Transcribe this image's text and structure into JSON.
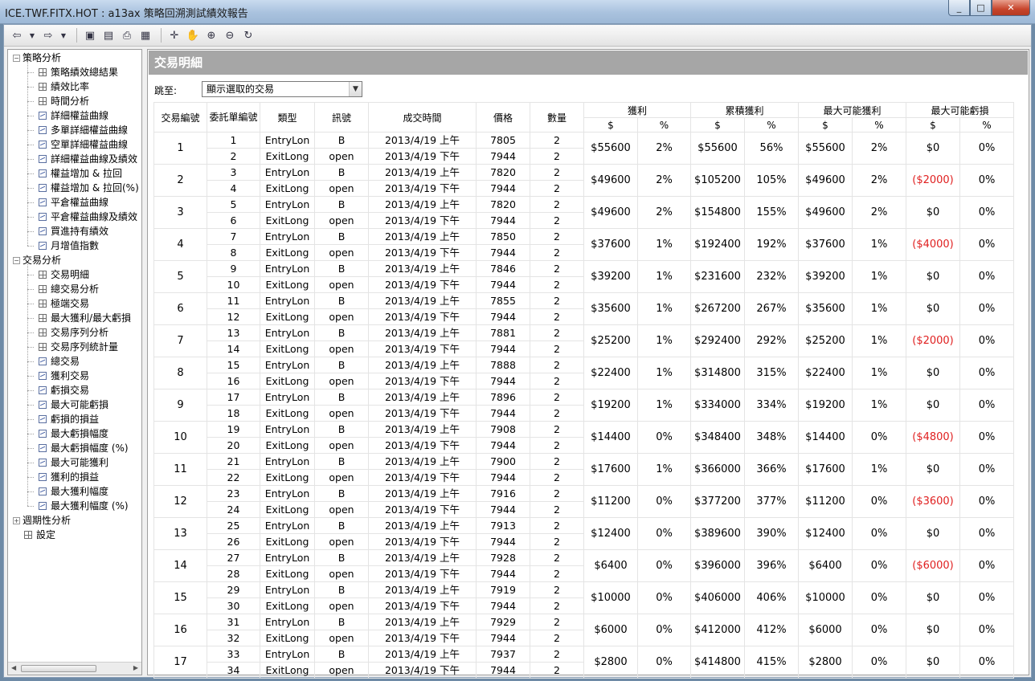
{
  "window": {
    "title": "ICE.TWF.FITX.HOT : a13ax 策略回溯測試績效報告",
    "min": "_",
    "max": "□",
    "close": "✕"
  },
  "tree": [
    {
      "label": "策略分析",
      "level": 0,
      "exp": "⊟"
    },
    {
      "label": "策略績效總結果",
      "level": 1,
      "icon": "grid"
    },
    {
      "label": "績效比率",
      "level": 1,
      "icon": "grid"
    },
    {
      "label": "時間分析",
      "level": 1,
      "icon": "grid"
    },
    {
      "label": "詳細權益曲線",
      "level": 1,
      "icon": "chart"
    },
    {
      "label": "多單詳細權益曲線",
      "level": 1,
      "icon": "chart"
    },
    {
      "label": "空單詳細權益曲線",
      "level": 1,
      "icon": "chart"
    },
    {
      "label": "詳細權益曲線及績效",
      "level": 1,
      "icon": "chart"
    },
    {
      "label": "權益增加 & 拉回",
      "level": 1,
      "icon": "chart"
    },
    {
      "label": "權益增加 & 拉回(%)",
      "level": 1,
      "icon": "chart"
    },
    {
      "label": "平倉權益曲線",
      "level": 1,
      "icon": "chart"
    },
    {
      "label": "平倉權益曲線及績效",
      "level": 1,
      "icon": "chart"
    },
    {
      "label": "買進持有績效",
      "level": 1,
      "icon": "chart"
    },
    {
      "label": "月增值指數",
      "level": 1,
      "icon": "chart"
    },
    {
      "label": "交易分析",
      "level": 0,
      "exp": "⊟"
    },
    {
      "label": "交易明細",
      "level": 1,
      "icon": "grid"
    },
    {
      "label": "總交易分析",
      "level": 1,
      "icon": "grid"
    },
    {
      "label": "極端交易",
      "level": 1,
      "icon": "grid"
    },
    {
      "label": "最大獲利/最大虧損",
      "level": 1,
      "icon": "grid"
    },
    {
      "label": "交易序列分析",
      "level": 1,
      "icon": "grid"
    },
    {
      "label": "交易序列統計量",
      "level": 1,
      "icon": "grid"
    },
    {
      "label": "總交易",
      "level": 1,
      "icon": "chart"
    },
    {
      "label": "獲利交易",
      "level": 1,
      "icon": "chart"
    },
    {
      "label": "虧損交易",
      "level": 1,
      "icon": "chart"
    },
    {
      "label": "最大可能虧損",
      "level": 1,
      "icon": "chart"
    },
    {
      "label": "虧損的損益",
      "level": 1,
      "icon": "chart"
    },
    {
      "label": "最大虧損幅度",
      "level": 1,
      "icon": "chart"
    },
    {
      "label": "最大虧損幅度 (%)",
      "level": 1,
      "icon": "chart"
    },
    {
      "label": "最大可能獲利",
      "level": 1,
      "icon": "chart"
    },
    {
      "label": "獲利的損益",
      "level": 1,
      "icon": "chart"
    },
    {
      "label": "最大獲利幅度",
      "level": 1,
      "icon": "chart"
    },
    {
      "label": "最大獲利幅度 (%)",
      "level": 1,
      "icon": "chart"
    },
    {
      "label": "週期性分析",
      "level": 0,
      "exp": "⊞"
    },
    {
      "label": "設定",
      "level": 0,
      "icon": "grid"
    }
  ],
  "page": {
    "header": "交易明細",
    "goto_label": "跳至:",
    "goto_value": "顯示選取的交易"
  },
  "columns": {
    "trade_no": "交易編號",
    "order_no": "委託單編號",
    "type": "類型",
    "signal": "訊號",
    "time": "成交時間",
    "price": "價格",
    "qty": "數量",
    "profit": "獲利",
    "cum_profit": "累積獲利",
    "max_profit": "最大可能獲利",
    "max_loss": "最大可能虧損",
    "usd": "$",
    "pct": "%"
  },
  "trades": [
    {
      "no": "1",
      "o1": "1",
      "o2": "2",
      "t1": "EntryLon",
      "t2": "ExitLong",
      "s1": "B",
      "s2": "open",
      "d1": "2013/4/19 上午",
      "d2": "2013/4/19 下午",
      "p1": "7805",
      "p2": "7944",
      "q1": "2",
      "q2": "2",
      "pf": "$55600",
      "pfp": "2%",
      "cum": "$55600",
      "cump": "56%",
      "mp": "$55600",
      "mpp": "2%",
      "ml": "$0",
      "mlp": "0%"
    },
    {
      "no": "2",
      "o1": "3",
      "o2": "4",
      "t1": "EntryLon",
      "t2": "ExitLong",
      "s1": "B",
      "s2": "open",
      "d1": "2013/4/19 上午",
      "d2": "2013/4/19 下午",
      "p1": "7820",
      "p2": "7944",
      "q1": "2",
      "q2": "2",
      "pf": "$49600",
      "pfp": "2%",
      "cum": "$105200",
      "cump": "105%",
      "mp": "$49600",
      "mpp": "2%",
      "ml": "($2000)",
      "mlp": "0%"
    },
    {
      "no": "3",
      "o1": "5",
      "o2": "6",
      "t1": "EntryLon",
      "t2": "ExitLong",
      "s1": "B",
      "s2": "open",
      "d1": "2013/4/19 上午",
      "d2": "2013/4/19 下午",
      "p1": "7820",
      "p2": "7944",
      "q1": "2",
      "q2": "2",
      "pf": "$49600",
      "pfp": "2%",
      "cum": "$154800",
      "cump": "155%",
      "mp": "$49600",
      "mpp": "2%",
      "ml": "$0",
      "mlp": "0%"
    },
    {
      "no": "4",
      "o1": "7",
      "o2": "8",
      "t1": "EntryLon",
      "t2": "ExitLong",
      "s1": "B",
      "s2": "open",
      "d1": "2013/4/19 上午",
      "d2": "2013/4/19 下午",
      "p1": "7850",
      "p2": "7944",
      "q1": "2",
      "q2": "2",
      "pf": "$37600",
      "pfp": "1%",
      "cum": "$192400",
      "cump": "192%",
      "mp": "$37600",
      "mpp": "1%",
      "ml": "($4000)",
      "mlp": "0%"
    },
    {
      "no": "5",
      "o1": "9",
      "o2": "10",
      "t1": "EntryLon",
      "t2": "ExitLong",
      "s1": "B",
      "s2": "open",
      "d1": "2013/4/19 上午",
      "d2": "2013/4/19 下午",
      "p1": "7846",
      "p2": "7944",
      "q1": "2",
      "q2": "2",
      "pf": "$39200",
      "pfp": "1%",
      "cum": "$231600",
      "cump": "232%",
      "mp": "$39200",
      "mpp": "1%",
      "ml": "$0",
      "mlp": "0%"
    },
    {
      "no": "6",
      "o1": "11",
      "o2": "12",
      "t1": "EntryLon",
      "t2": "ExitLong",
      "s1": "B",
      "s2": "open",
      "d1": "2013/4/19 上午",
      "d2": "2013/4/19 下午",
      "p1": "7855",
      "p2": "7944",
      "q1": "2",
      "q2": "2",
      "pf": "$35600",
      "pfp": "1%",
      "cum": "$267200",
      "cump": "267%",
      "mp": "$35600",
      "mpp": "1%",
      "ml": "$0",
      "mlp": "0%"
    },
    {
      "no": "7",
      "o1": "13",
      "o2": "14",
      "t1": "EntryLon",
      "t2": "ExitLong",
      "s1": "B",
      "s2": "open",
      "d1": "2013/4/19 上午",
      "d2": "2013/4/19 下午",
      "p1": "7881",
      "p2": "7944",
      "q1": "2",
      "q2": "2",
      "pf": "$25200",
      "pfp": "1%",
      "cum": "$292400",
      "cump": "292%",
      "mp": "$25200",
      "mpp": "1%",
      "ml": "($2000)",
      "mlp": "0%"
    },
    {
      "no": "8",
      "o1": "15",
      "o2": "16",
      "t1": "EntryLon",
      "t2": "ExitLong",
      "s1": "B",
      "s2": "open",
      "d1": "2013/4/19 上午",
      "d2": "2013/4/19 下午",
      "p1": "7888",
      "p2": "7944",
      "q1": "2",
      "q2": "2",
      "pf": "$22400",
      "pfp": "1%",
      "cum": "$314800",
      "cump": "315%",
      "mp": "$22400",
      "mpp": "1%",
      "ml": "$0",
      "mlp": "0%"
    },
    {
      "no": "9",
      "o1": "17",
      "o2": "18",
      "t1": "EntryLon",
      "t2": "ExitLong",
      "s1": "B",
      "s2": "open",
      "d1": "2013/4/19 上午",
      "d2": "2013/4/19 下午",
      "p1": "7896",
      "p2": "7944",
      "q1": "2",
      "q2": "2",
      "pf": "$19200",
      "pfp": "1%",
      "cum": "$334000",
      "cump": "334%",
      "mp": "$19200",
      "mpp": "1%",
      "ml": "$0",
      "mlp": "0%"
    },
    {
      "no": "10",
      "o1": "19",
      "o2": "20",
      "t1": "EntryLon",
      "t2": "ExitLong",
      "s1": "B",
      "s2": "open",
      "d1": "2013/4/19 上午",
      "d2": "2013/4/19 下午",
      "p1": "7908",
      "p2": "7944",
      "q1": "2",
      "q2": "2",
      "pf": "$14400",
      "pfp": "0%",
      "cum": "$348400",
      "cump": "348%",
      "mp": "$14400",
      "mpp": "0%",
      "ml": "($4800)",
      "mlp": "0%"
    },
    {
      "no": "11",
      "o1": "21",
      "o2": "22",
      "t1": "EntryLon",
      "t2": "ExitLong",
      "s1": "B",
      "s2": "open",
      "d1": "2013/4/19 上午",
      "d2": "2013/4/19 下午",
      "p1": "7900",
      "p2": "7944",
      "q1": "2",
      "q2": "2",
      "pf": "$17600",
      "pfp": "1%",
      "cum": "$366000",
      "cump": "366%",
      "mp": "$17600",
      "mpp": "1%",
      "ml": "$0",
      "mlp": "0%"
    },
    {
      "no": "12",
      "o1": "23",
      "o2": "24",
      "t1": "EntryLon",
      "t2": "ExitLong",
      "s1": "B",
      "s2": "open",
      "d1": "2013/4/19 上午",
      "d2": "2013/4/19 下午",
      "p1": "7916",
      "p2": "7944",
      "q1": "2",
      "q2": "2",
      "pf": "$11200",
      "pfp": "0%",
      "cum": "$377200",
      "cump": "377%",
      "mp": "$11200",
      "mpp": "0%",
      "ml": "($3600)",
      "mlp": "0%"
    },
    {
      "no": "13",
      "o1": "25",
      "o2": "26",
      "t1": "EntryLon",
      "t2": "ExitLong",
      "s1": "B",
      "s2": "open",
      "d1": "2013/4/19 上午",
      "d2": "2013/4/19 下午",
      "p1": "7913",
      "p2": "7944",
      "q1": "2",
      "q2": "2",
      "pf": "$12400",
      "pfp": "0%",
      "cum": "$389600",
      "cump": "390%",
      "mp": "$12400",
      "mpp": "0%",
      "ml": "$0",
      "mlp": "0%"
    },
    {
      "no": "14",
      "o1": "27",
      "o2": "28",
      "t1": "EntryLon",
      "t2": "ExitLong",
      "s1": "B",
      "s2": "open",
      "d1": "2013/4/19 上午",
      "d2": "2013/4/19 下午",
      "p1": "7928",
      "p2": "7944",
      "q1": "2",
      "q2": "2",
      "pf": "$6400",
      "pfp": "0%",
      "cum": "$396000",
      "cump": "396%",
      "mp": "$6400",
      "mpp": "0%",
      "ml": "($6000)",
      "mlp": "0%"
    },
    {
      "no": "15",
      "o1": "29",
      "o2": "30",
      "t1": "EntryLon",
      "t2": "ExitLong",
      "s1": "B",
      "s2": "open",
      "d1": "2013/4/19 上午",
      "d2": "2013/4/19 下午",
      "p1": "7919",
      "p2": "7944",
      "q1": "2",
      "q2": "2",
      "pf": "$10000",
      "pfp": "0%",
      "cum": "$406000",
      "cump": "406%",
      "mp": "$10000",
      "mpp": "0%",
      "ml": "$0",
      "mlp": "0%"
    },
    {
      "no": "16",
      "o1": "31",
      "o2": "32",
      "t1": "EntryLon",
      "t2": "ExitLong",
      "s1": "B",
      "s2": "open",
      "d1": "2013/4/19 上午",
      "d2": "2013/4/19 下午",
      "p1": "7929",
      "p2": "7944",
      "q1": "2",
      "q2": "2",
      "pf": "$6000",
      "pfp": "0%",
      "cum": "$412000",
      "cump": "412%",
      "mp": "$6000",
      "mpp": "0%",
      "ml": "$0",
      "mlp": "0%"
    },
    {
      "no": "17",
      "o1": "33",
      "o2": "34",
      "t1": "EntryLon",
      "t2": "ExitLong",
      "s1": "B",
      "s2": "open",
      "d1": "2013/4/19 上午",
      "d2": "2013/4/19 下午",
      "p1": "7937",
      "p2": "7944",
      "q1": "2",
      "q2": "2",
      "pf": "$2800",
      "pfp": "0%",
      "cum": "$414800",
      "cump": "415%",
      "mp": "$2800",
      "mpp": "0%",
      "ml": "$0",
      "mlp": "0%"
    }
  ],
  "colors": {
    "negative": "#e02020",
    "header_bar": "#a6a6a6"
  }
}
